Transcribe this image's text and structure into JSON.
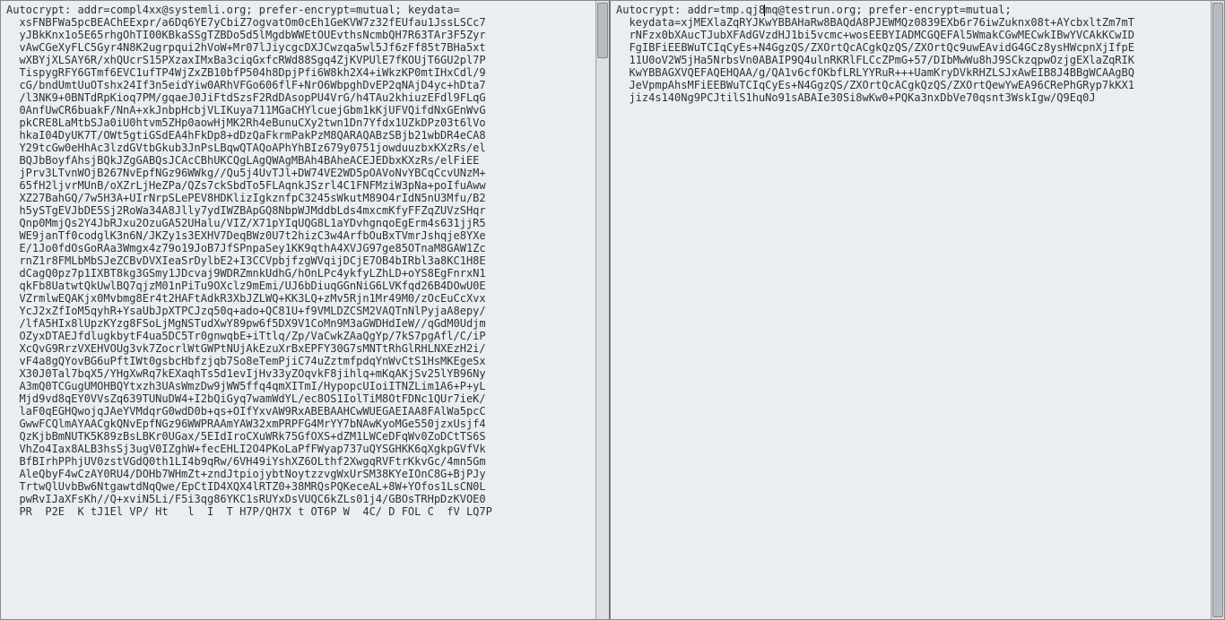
{
  "left": {
    "header": "Autocrypt: addr=compl4xx@systemli.org; prefer-encrypt=mutual; keydata=",
    "keydata": [
      "  xsFNBFWa5pcBEAChEExpr/a6Dq6YE7yCbiZ7ogvatOm0cEh1GeKVW7z32fEUfau1JssLSCc7",
      "  yJBkKnx1o5E65rhgOhTI00KBkaSSgTZBDo5d5lMgdbWWEtOUEvthsNcmbQH7R63TAr3F5Zyr",
      "  vAwCGeXyFLC5Gyr4N8K2ugrpqui2hVoW+Mr07lJiycgcDXJCwzqa5wl5Jf6zFf85t7BHa5xt",
      "  wXBYjXLSAY6R/xhQUcrS15PXzaxIMxBa3ciqGxfcRWd88Sgq4ZjKVPUlE7fKOUjT6GU2pl7P",
      "  TispygRFY6GTmf6EVC1ufTP4WjZxZB10bfP504h8DpjPfi6W8kh2X4+iWkzKP0mtIHxCdl/9",
      "  cG/bndUmtUuOTshx24If3n5eidYiw0ARhVFGo606flF+NrO6WbpghDvEP2qNAjD4yc+hDta7",
      "  /l3NK9+0BNTdRpKioq7PM/gqaeJ0JiFtdSzsF2RdDAsopPU4VrG/h4TAu2khiuzEFdl9FLqG",
      "  0AnfUwCR6buakF/NnA+xkJnbpHcbjVLIKuya711MGaCHYlcuejGbm1kKjUFVQifdNxGEnWvG",
      "  pkCRE8LaMtbSJa0iU0htvm5ZHp0aowHjMK2Rh4eBunuCXy2twn1Dn7Yfdx1UZkDPz03t6lVo",
      "  hkaI04DyUK7T/OWt5gtiGSdEA4hFkDp8+dDzQaFkrmPakPzM8QARAQABzSBjb21wbDR4eCA8",
      "  Y29tcGw0eHhAc3lzdGVtbGkub3JnPsLBqwQTAQoAPhYhBIz679y0751jowduuzbxKXzRs/el",
      "  BQJbBoyfAhsjBQkJZgGABQsJCAcCBhUKCQgLAgQWAgMBAh4BAheACEJEDbxKXzRs/elFiEE",
      "  jPrv3LTvnWOjB267NvEpfNGz96WWkg//Qu5j4UvTJl+DW74VE2WD5pOAVoNvYBCqCcvUNzM+",
      "  65fH2ljvrMUnB/oXZrLjHeZPa/QZs7ckSbdTo5FLAqnkJSzrl4C1FNFMziW3pNa+poIfuAww",
      "  XZ27BahGQ/7w5H3A+UIrNrpSLePEV8HDKlizIgkznfpC3245sWkutM89O4rIdN5nU3Mfu/B2",
      "  h5ySTgEVJbDE5Sj2RoWa34A8Jlly7ydIWZBApGQ8NbpWJMddbLds4mxcmKfyFFZqZUVzSHqr",
      "  Qnp0MmjQs2Y4JbRJxu2OzuGA52UHalu/VIZ/X71pYIqUQG8L1aYDvhgnqoEgErm4s631jjR5",
      "  WE9janTf0codglK3n6N/JKZy1s3EXHV7DeqBWz0U7t2hizC3w4ArfbOuBxTVmrJshqje8YXe",
      "  E/1Jo0fdOsGoRAa3Wmgx4z79o19JoB7JfSPnpaSey1KK9qthA4XVJG97ge85OTnaM8GAW1Zc",
      "  rnZ1r8FMLbMbSJeZCBvDVXIeaSrDylbE2+I3CCVpbjfzgWVqijDCjE7OB4bIRbl3a8KC1H8E",
      "  dCagQ0pz7p1IXBT8kg3GSmy1JDcvaj9WDRZmnkUdhG/hOnLPc4ykfyLZhLD+oYS8EgFnrxN1",
      "  qkFb8UatwtQkUwlBQ7qjzM01nPiTu9OXclz9mEmi/UJ6bDiuqGGnNiG6LVKfqd26B4DOwU0E",
      "  VZrmlwEQAKjx0Mvbmg8Er4t2HAFtAdkR3XbJZLWQ+KK3LQ+zMv5Rjn1Mr49M0/zOcEuCcXvx",
      "  YcJ2xZfIoM5qyhR+YsaUbJpXTPCJzq50q+ado+QC81U+f9VMLDZCSM2VAQTnNlPyjaA8epy/",
      "  /lfA5HIx8lUpzKYzg8FSoLjMgNSTudXwY89pw6f5DX9V1CoMn9M3aGWDHdIeW//qGdM0Udjm",
      "  OZyxDTAEJfdlugkbytF4ua5DC5Tr0gnwqbE+iTtlq/Zp/VaCwkZAaQgYp/7kS7pgAfl/C/iP",
      "  XcQvG9RrzVXEHVOUg3vk7ZocrlWtGWPtNUjAkEzuXrBxEPFY30G7sMNTtRhGlRHLNXEzH2i/",
      "  vF4a8gQYovBG6uPftIWt0gsbcHbfzjqb7So8eTemPjiC74uZztmfpdqYnWvCtS1HsMKEgeSx",
      "  X30J0Tal7bqX5/YHgXwRq7kEXaqhTs5d1evIjHv33yZOqvkF8jihlq+mKqAKjSv25lYB96Ny",
      "  A3mQ0TCGugUMOHBQYtxzh3UAsWmzDw9jWW5ffq4qmXITmI/HypopcUIoiITNZLim1A6+P+yL",
      "  Mjd9vd8qEY0VVsZq639TUNuDW4+I2bQiGyq7wamWdYL/ec8OS1IolTiM8OtFDNc1QUr7ieK/",
      "  laF0qEGHQwojqJAeYVMdqrG0wdD0b+qs+OIfYxvAW9RxABEBAAHCwWUEGAEIAA8FAlWa5pcC",
      "  GwwFCQlmAYAACgkQNvEpfNGz96WWPRAAmYAW32xmPRPFG4MrYY7bNAwKyoMGe550jzxUsjf4",
      "  QzKjbBmNUTK5K89zBsLBKr0UGax/5EIdIroCXuWRk75GfOXS+dZM1LWCeDFqWv0ZoDCtTS6S",
      "  VhZo4Iax8ALB3hsSj3ugV0IZghW+fecEHLI2O4PKoLaPfFWyap737uQYSGHKK6qXgkpGVfVk",
      "  BfBIrhPPhjUV0zstVGdQ0th1LI4b9qRw/6VH49iYshXZ6OLthf2XwgqRVFtrKkvGc/4mn5Gm",
      "  AleQbyF4wCzAY0RU4/DOHb7WHmZt+zndJtpiojybtNoytzzvgWxUrSM38KYeIOnC8G+BjPJy",
      "  TrtwQlUvbBw6NtgawtdNqQwe/EpCtID4XQX4lRTZ0+38MRQsPQKeceAL+8W+YOfos1LsCN0L",
      "  pwRvIJaXFsKh//Q+xviN5Li/F5i3qg86YKC1sRUYxDsVUQC6kZLs01j4/GBOsTRHpDzKVOE0"
    ],
    "overflow_hint": "  PR  P2E  K tJ1El VP/ Ht   l  I  T H7P/QH7X t OT6P W  4C/ D FOL C  fV LQ7P"
  },
  "right": {
    "header": "Autocrypt: addr=tmp.qj8mq@testrun.org; prefer-encrypt=mutual;",
    "cursor_before": "Autocrypt: addr=tmp.qj8",
    "cursor_after": "mq@testrun.org; prefer-encrypt=mutual;",
    "keydata": [
      "  keydata=xjMEXlaZqRYJKwYBBAHaRw8BAQdA8PJEWMQz0839EXb6r76iwZuknx08t+AYcbxltZm7mT",
      "  rNFzx0bXAucTJubXFAdGVzdHJ1bi5vcmc+wosEEBYIADMCGQEFAl5WmakCGwMECwkIBwYVCAkKCwID",
      "  FgIBFiEEBWuTCIqCyEs+N4GgzQS/ZXOrtQcACgkQzQS/ZXOrtQc9uwEAvidG4GCz8ysHWcpnXjIfpE",
      "  11U0oV2W5jHa5NrbsVn0ABAIP9Q4ulnRKRlFLCcZPmG+57/DIbMwWu8hJ9SCkzqpwOzjgEXlaZqRIK",
      "  KwYBBAGXVQEFAQEHQAA/g/QA1v6cfOKbfLRLYYRuR+++UamKryDVkRHZLSJxAwEIB8J4BBgWCAAgBQ",
      "  JeVpmpAhsMFiEEBWuTCIqCyEs+N4GgzQS/ZXOrtQcACgkQzQS/ZXOrtQewYwEA96CRePhGRyp7kKX1",
      "  jiz4s140Ng9PCJtilS1huNo91sABAIe30Si8wKw0+PQKa3nxDbVe70qsnt3WskIgw/Q9Eq0J"
    ]
  }
}
